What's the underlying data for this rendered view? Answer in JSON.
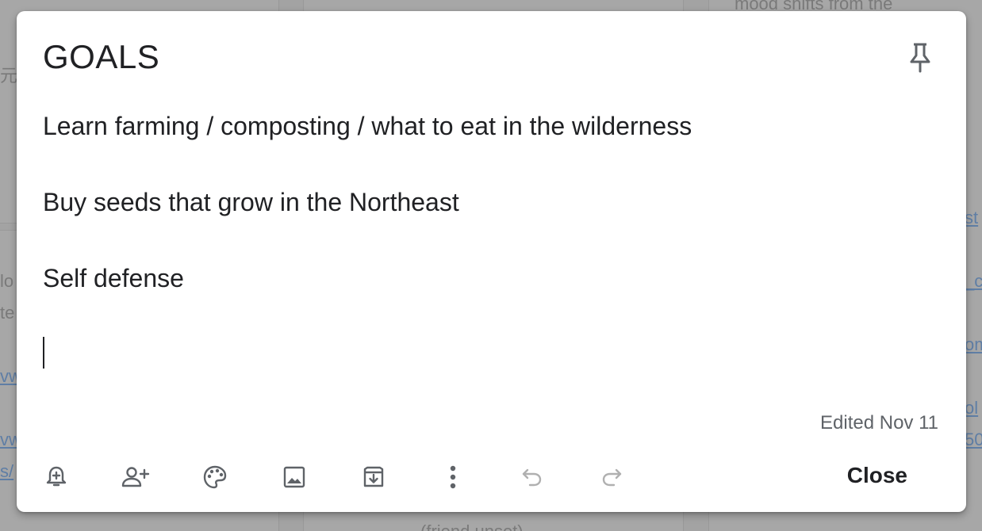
{
  "note": {
    "title": "GOALS",
    "lines": [
      "Learn farming / composting / what to eat in the wilderness",
      "Buy seeds that grow in the Northeast",
      "Self defense"
    ],
    "edited_label": "Edited Nov 11",
    "close_label": "Close"
  },
  "toolbar_icons": [
    "remind-me-icon",
    "collaborator-icon",
    "background-options-icon",
    "add-image-icon",
    "archive-icon",
    "more-icon",
    "undo-icon",
    "redo-icon"
  ],
  "background": {
    "top_right_text": "mood shifts from the",
    "left_cjk": "元代",
    "left_frag_1": "lo",
    "left_frag_2": "te",
    "left_link_1": "vw",
    "left_link_2": "vw",
    "left_link_3": "s/",
    "bottom_text": "(friend unset)",
    "right_link_1": "st",
    "right_link_2": "_c",
    "right_link_3": "om",
    "right_link_4": "ol",
    "right_link_5": "50"
  },
  "colors": {
    "text": "#202124",
    "secondary": "#5f6368",
    "disabled": "#b0b0b0",
    "card": "#ffffff"
  }
}
